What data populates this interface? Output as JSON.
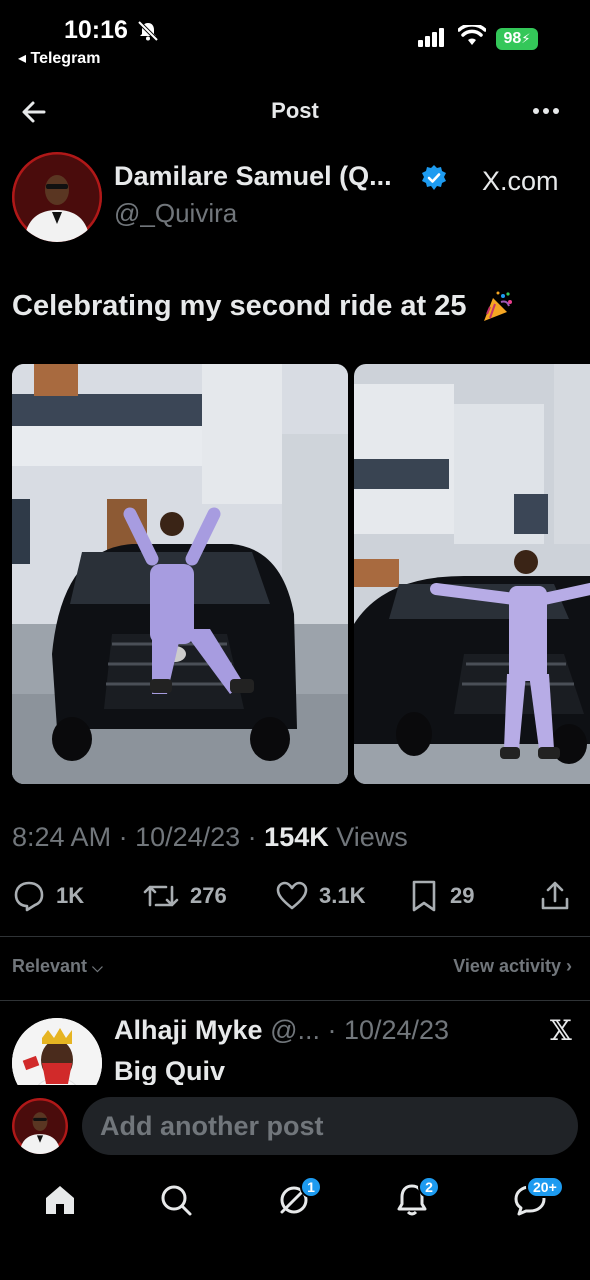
{
  "status_bar": {
    "time": "10:16",
    "back_app": "◂ Telegram",
    "battery": "98"
  },
  "header": {
    "title": "Post"
  },
  "post": {
    "author_name": "Damilare Samuel (Q...",
    "author_handle": "@_Quivira",
    "source": "X.com",
    "text": "Celebrating my second ride at 25",
    "time": "8:24 AM",
    "date": "10/24/23",
    "views_count": "154K",
    "views_label": "Views",
    "replies": "1K",
    "reposts": "276",
    "likes": "3.1K",
    "bookmarks": "29"
  },
  "sort": {
    "label": "Relevant",
    "view_activity": "View activity"
  },
  "reply": {
    "name": "Alhaji Myke",
    "rest": " @... · 10/24/23",
    "text": "Big Quiv"
  },
  "compose": {
    "placeholder": "Add another post"
  },
  "tabs": {
    "grok_badge": "1",
    "notifications_badge": "2",
    "messages_badge": "20+"
  },
  "colors": {
    "accent": "#1d9bf0",
    "battery": "#34c759",
    "muted": "#71767b"
  }
}
